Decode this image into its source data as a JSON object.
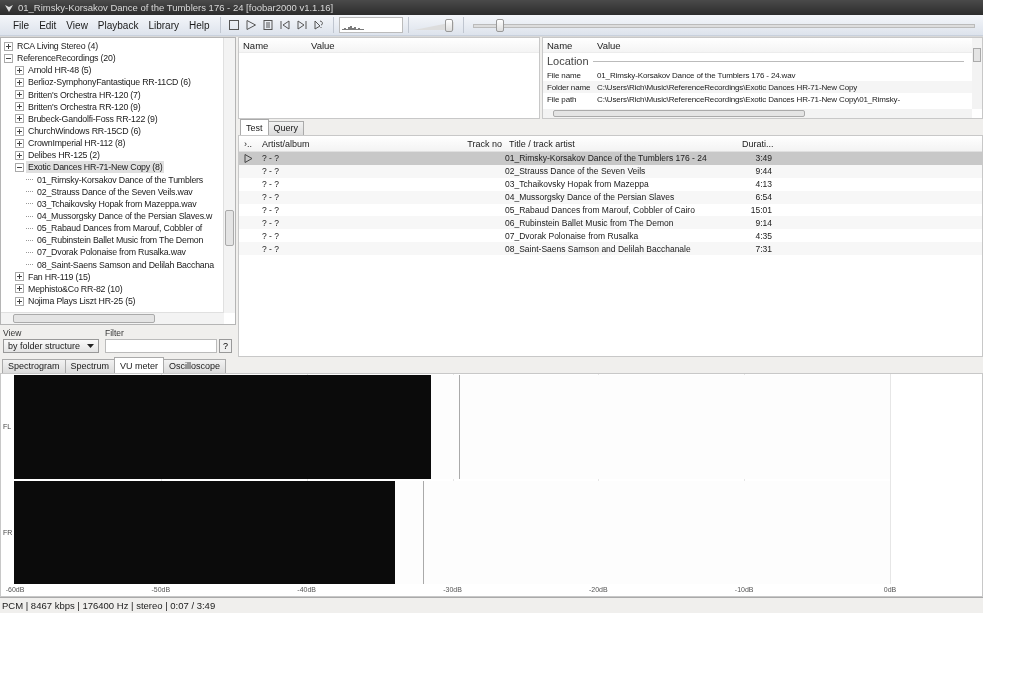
{
  "window": {
    "title": "01_Rimsky-Korsakov Dance of the Tumblers 176 - 24   [foobar2000 v1.1.16]"
  },
  "menu": [
    "File",
    "Edit",
    "View",
    "Playback",
    "Library",
    "Help"
  ],
  "toolbar": {
    "buttons": [
      {
        "kind": "stop"
      },
      {
        "kind": "play"
      },
      {
        "kind": "pause"
      },
      {
        "kind": "previous"
      },
      {
        "kind": "next"
      },
      {
        "kind": "random"
      }
    ]
  },
  "volume": {
    "level": 0.92
  },
  "seek": {
    "level": 0.03
  },
  "library_tree": {
    "items": [
      {
        "label": "RCA Living Stereo (4)",
        "kind": "folder",
        "expanded": false,
        "selected": false
      },
      {
        "label": "ReferenceRecordings (20)",
        "kind": "folder",
        "expanded": true,
        "selected": false,
        "children": [
          {
            "label": "Arnold HR-48 (5)",
            "kind": "folder",
            "expanded": false,
            "selected": false
          },
          {
            "label": "Berlioz-SymphonyFantastique RR-11CD (6)",
            "kind": "folder",
            "expanded": false,
            "selected": false
          },
          {
            "label": "Britten's Orchestra HR-120 (7)",
            "kind": "folder",
            "expanded": false,
            "selected": false
          },
          {
            "label": "Britten's Orchestra RR-120 (9)",
            "kind": "folder",
            "expanded": false,
            "selected": false
          },
          {
            "label": "Brubeck-Gandolfi-Foss RR-122 (9)",
            "kind": "folder",
            "expanded": false,
            "selected": false
          },
          {
            "label": "ChurchWindows RR-15CD (6)",
            "kind": "folder",
            "expanded": false,
            "selected": false
          },
          {
            "label": "CrownImperial HR-112 (8)",
            "kind": "folder",
            "expanded": false,
            "selected": false
          },
          {
            "label": "Delibes HR-125 (2)",
            "kind": "folder",
            "expanded": false,
            "selected": false
          },
          {
            "label": "Exotic Dances HR-71-New Copy (8)",
            "kind": "folder",
            "expanded": true,
            "selected": true,
            "children": [
              {
                "label": "01_Rimsky-Korsakov Dance of the Tumblers",
                "kind": "file",
                "selected": false
              },
              {
                "label": "02_Strauss Dance of the Seven Veils.wav",
                "kind": "file",
                "selected": false
              },
              {
                "label": "03_Tchaikovsky Hopak from Mazeppa.wav",
                "kind": "file",
                "selected": false
              },
              {
                "label": "04_Mussorgsky Dance of the Persian Slaves.w",
                "kind": "file",
                "selected": false
              },
              {
                "label": "05_Rabaud Dances from Marouf, Cobbler of",
                "kind": "file",
                "selected": false
              },
              {
                "label": "06_Rubinstein Ballet Music from The Demon",
                "kind": "file",
                "selected": false
              },
              {
                "label": "07_Dvorak Polonaise from Rusalka.wav",
                "kind": "file",
                "selected": false
              },
              {
                "label": "08_Saint-Saens Samson and Delilah Bacchana",
                "kind": "file",
                "selected": false
              }
            ]
          },
          {
            "label": "Fan HR-119 (15)",
            "kind": "folder",
            "expanded": false,
            "selected": false
          },
          {
            "label": "Mephisto&Co RR-82 (10)",
            "kind": "folder",
            "expanded": false,
            "selected": false
          },
          {
            "label": "Nojima Plays Liszt HR-25 (5)",
            "kind": "folder",
            "expanded": false,
            "selected": false
          }
        ]
      }
    ]
  },
  "view_filter": {
    "view_label": "View",
    "view_value": "by folder structure",
    "filter_label": "Filter",
    "help_button": "?"
  },
  "properties_left": {
    "columns": [
      "Name",
      "Value"
    ]
  },
  "properties_right": {
    "columns": [
      "Name",
      "Value"
    ],
    "group": "Location",
    "rows": [
      {
        "name": "File name",
        "value": "01_Rimsky-Korsakov Dance of the Tumblers 176 - 24.wav"
      },
      {
        "name": "Folder name",
        "value": "C:\\Users\\Rich\\Music\\ReferenceRecordings\\Exotic Dances HR-71-New Copy"
      },
      {
        "name": "File path",
        "value": "C:\\Users\\Rich\\Music\\ReferenceRecordings\\Exotic Dances HR-71-New Copy\\01_Rimsky-"
      }
    ]
  },
  "playlist_tabs": [
    {
      "label": "Test",
      "selected": true
    },
    {
      "label": "Query",
      "selected": false
    }
  ],
  "playlist": {
    "columns": [
      "›..",
      "Artist/album",
      "Track no",
      "Title / track artist",
      "Durati..."
    ],
    "rows": [
      {
        "playing": true,
        "selected": true,
        "artist_album": "? - ?",
        "title": "01_Rimsky-Korsakov Dance of the Tumblers 176 - 24",
        "duration": "3:49"
      },
      {
        "playing": false,
        "selected": false,
        "artist_album": "? - ?",
        "title": "02_Strauss Dance of the Seven Veils",
        "duration": "9:44"
      },
      {
        "playing": false,
        "selected": false,
        "artist_album": "? - ?",
        "title": "03_Tchaikovsky Hopak from Mazeppa",
        "duration": "4:13"
      },
      {
        "playing": false,
        "selected": false,
        "artist_album": "? - ?",
        "title": "04_Mussorgsky Dance of the Persian Slaves",
        "duration": "6:54"
      },
      {
        "playing": false,
        "selected": false,
        "artist_album": "? - ?",
        "title": "05_Rabaud Dances from Marouf, Cobbler of Cairo",
        "duration": "15:01"
      },
      {
        "playing": false,
        "selected": false,
        "artist_album": "? - ?",
        "title": "06_Rubinstein Ballet Music from The Demon",
        "duration": "9:14"
      },
      {
        "playing": false,
        "selected": false,
        "artist_album": "? - ?",
        "title": "07_Dvorak Polonaise from Rusalka",
        "duration": "4:35"
      },
      {
        "playing": false,
        "selected": false,
        "artist_album": "? - ?",
        "title": "08_Saint-Saens Samson and Delilah Bacchanale",
        "duration": "7:31"
      }
    ]
  },
  "visualization_tabs": [
    {
      "label": "Spectrogram",
      "selected": false
    },
    {
      "label": "Spectrum",
      "selected": false
    },
    {
      "label": "VU meter",
      "selected": true
    },
    {
      "label": "Oscilloscope",
      "selected": false
    }
  ],
  "vu_meter": {
    "channels": [
      {
        "name": "FL",
        "level": 0.476
      },
      {
        "name": "FR",
        "level": 0.435
      }
    ],
    "scale": [
      "-60dB",
      "-50dB",
      "-40dB",
      "-30dB",
      "-20dB",
      "-10dB",
      "0dB"
    ]
  },
  "status_bar": "PCM | 8467 kbps | 176400 Hz | stereo | 0:07 / 3:49"
}
